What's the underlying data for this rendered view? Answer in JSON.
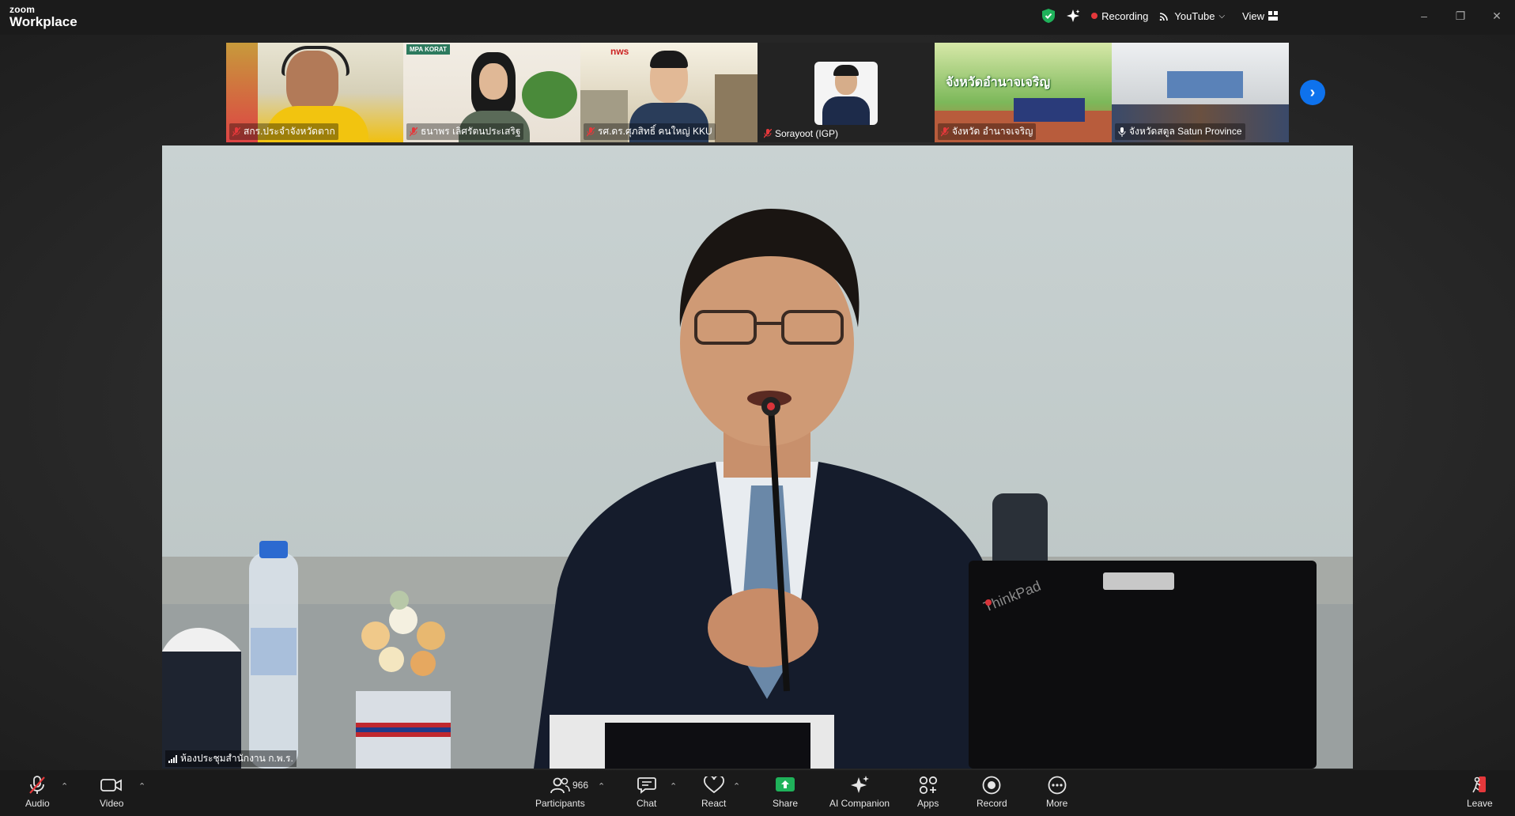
{
  "app": {
    "brand_small": "zoom",
    "brand_big": "Workplace"
  },
  "titlebar": {
    "recording_label": "Recording",
    "stream_label": "YouTube",
    "view_label": "View",
    "colors": {
      "security": "#1fb25a",
      "recording": "#e5383b"
    }
  },
  "thumbnails": [
    {
      "name": "สกร.ประจำจังหวัดตาก",
      "muted": true
    },
    {
      "name": "ธนาพร เลิศรัตนประเสริฐ",
      "muted": true
    },
    {
      "name": "รศ.ดร.ศุภสิทธิ์ คนใหญ่ KKU",
      "muted": true
    },
    {
      "name": "Sorayoot (IGP)",
      "muted": true
    },
    {
      "name": "จังหวัด อำนาจเจริญ",
      "muted": true
    },
    {
      "name": "จังหวัดสตูล Satun Province",
      "muted": false
    }
  ],
  "thumb_overlays": {
    "korat_logo": "MPA KORAT",
    "nws_logo": "nws",
    "amnat_banner": "จังหวัดอำนาจเจริญ"
  },
  "main": {
    "speaker_name": "ห้องประชุมสำนักงาน ก.พ.ร.",
    "laptop_brand": "ThinkPad"
  },
  "toolbar": {
    "audio": "Audio",
    "video": "Video",
    "participants": "Participants",
    "participants_count": "966",
    "chat": "Chat",
    "react": "React",
    "share": "Share",
    "ai_companion": "AI Companion",
    "apps": "Apps",
    "record": "Record",
    "more": "More",
    "leave": "Leave",
    "colors": {
      "share": "#1fb25a",
      "leave": "#e5383b"
    }
  }
}
